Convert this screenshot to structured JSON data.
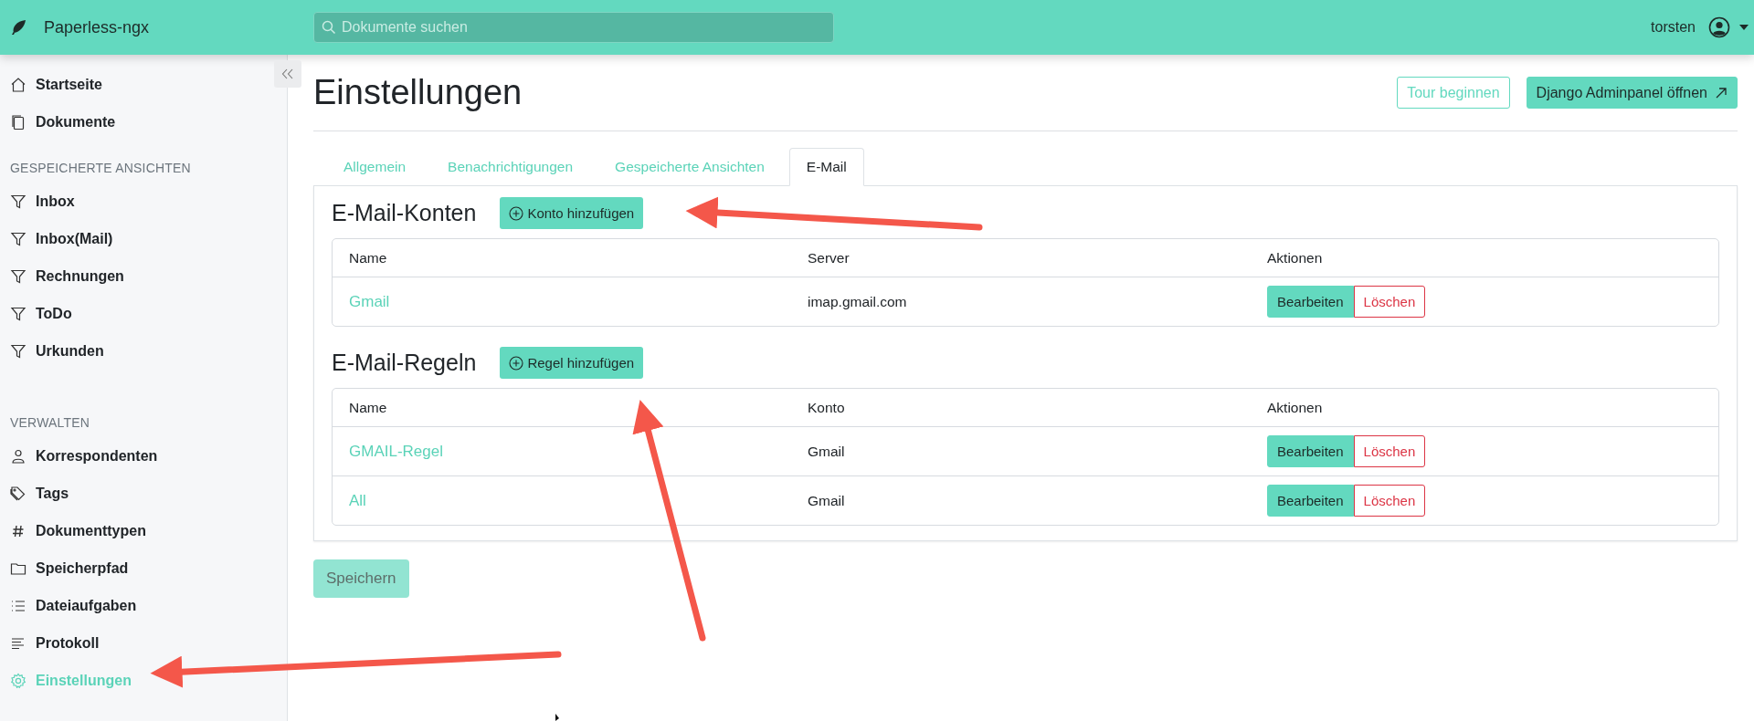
{
  "app": {
    "name": "Paperless-ngx"
  },
  "search": {
    "placeholder": "Dokumente suchen"
  },
  "user": {
    "name": "torsten"
  },
  "sidebar": {
    "sections": [
      {
        "items": [
          {
            "label": "Startseite",
            "selected": false
          },
          {
            "label": "Dokumente",
            "selected": false
          }
        ]
      },
      {
        "heading": "GESPEICHERTE ANSICHTEN",
        "items": [
          {
            "label": "Inbox",
            "selected": false
          },
          {
            "label": "Inbox(Mail)",
            "selected": false
          },
          {
            "label": "Rechnungen",
            "selected": false
          },
          {
            "label": "ToDo",
            "selected": false
          },
          {
            "label": "Urkunden",
            "selected": false
          }
        ]
      },
      {
        "heading": "VERWALTEN",
        "items": [
          {
            "label": "Korrespondenten",
            "selected": false
          },
          {
            "label": "Tags",
            "selected": false
          },
          {
            "label": "Dokumenttypen",
            "selected": false
          },
          {
            "label": "Speicherpfad",
            "selected": false
          },
          {
            "label": "Dateiaufgaben",
            "selected": false
          },
          {
            "label": "Protokoll",
            "selected": false
          },
          {
            "label": "Einstellungen",
            "selected": true
          }
        ]
      }
    ]
  },
  "page": {
    "title": "Einstellungen",
    "actions": [
      {
        "label": "Tour beginnen",
        "kind": "outline"
      },
      {
        "label": "Django Adminpanel öffnen",
        "kind": "primary"
      }
    ]
  },
  "tabs": [
    {
      "label": "Allgemein",
      "selected": false
    },
    {
      "label": "Benachrichtigungen",
      "selected": false
    },
    {
      "label": "Gespeicherte Ansichten",
      "selected": false
    },
    {
      "label": "E-Mail",
      "selected": true
    }
  ],
  "sections": [
    {
      "title": "E-Mail-Konten",
      "add_button": "Konto hinzufügen",
      "table": {
        "columns": [
          "Name",
          "Server",
          "Aktionen"
        ],
        "rows": [
          {
            "name": "Gmail",
            "value": "imap.gmail.com",
            "actions": [
              "Bearbeiten",
              "Löschen"
            ]
          }
        ]
      }
    },
    {
      "title": "E-Mail-Regeln",
      "add_button": "Regel hinzufügen",
      "table": {
        "columns": [
          "Name",
          "Konto",
          "Aktionen"
        ],
        "rows": [
          {
            "name": "GMAIL-Regel",
            "value": "Gmail",
            "actions": [
              "Bearbeiten",
              "Löschen"
            ]
          },
          {
            "name": "All",
            "value": "Gmail",
            "actions": [
              "Bearbeiten",
              "Löschen"
            ]
          }
        ]
      }
    }
  ],
  "save_button": {
    "label": "Speichern",
    "disabled": true
  }
}
